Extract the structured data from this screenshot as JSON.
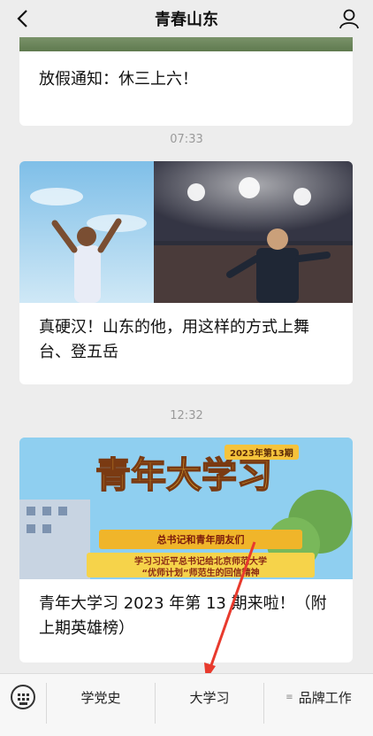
{
  "header": {
    "title": "青春山东",
    "back_icon": "chevron-left-icon",
    "profile_icon": "person-icon"
  },
  "posts": [
    {
      "caption": "放假通知：休三上六！"
    },
    {
      "time": "07:33",
      "caption": "真硬汉！山东的他，用这样的方式上舞台、登五岳"
    },
    {
      "time": "12:32",
      "caption": "青年大学习 2023 年第 13 期来啦！（附上期英雄榜）",
      "image_text": {
        "big": "青年大学习",
        "issue": "2023年第13期",
        "ribbon": "总书记和青年朋友们",
        "line1": "学习习近平总书记给北京师范大学",
        "line2": "“优师计划”师范生的回信精神"
      }
    }
  ],
  "menu": {
    "items": [
      "学党史",
      "大学习",
      "品牌工作"
    ],
    "keyboard_icon": "keyboard-icon",
    "submenu_icon": "menu-lines-icon"
  },
  "colors": {
    "background": "#ededed",
    "card": "#ffffff",
    "arrow": "#e83a2d",
    "banner_gold": "#f0b52a",
    "sky": "#8fcff0"
  }
}
